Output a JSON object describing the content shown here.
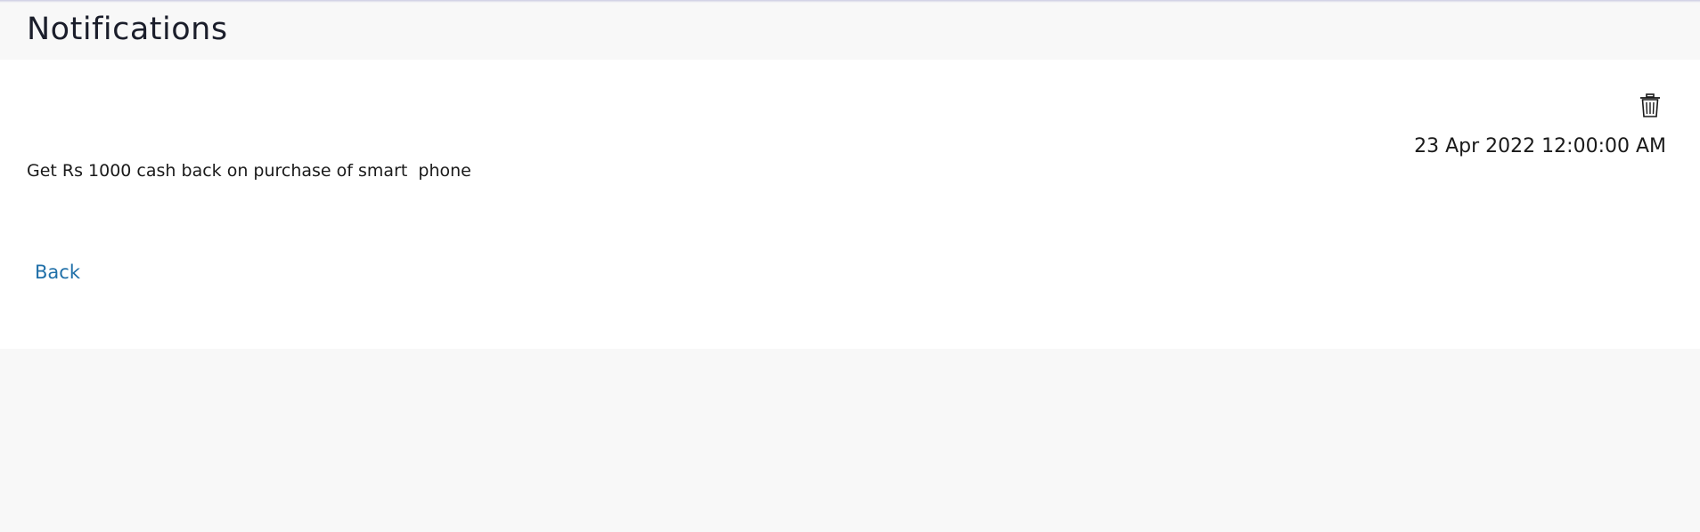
{
  "header": {
    "title": "Notifications"
  },
  "notification": {
    "message": "Get Rs 1000 cash back on purchase of smart  phone",
    "timestamp": "23 Apr 2022 12:00:00 AM",
    "delete_icon": "trash-icon"
  },
  "actions": {
    "back_label": "Back"
  },
  "colors": {
    "link": "#1f6fa8",
    "page_background": "#f8f8f8",
    "panel_background": "#ffffff",
    "text": "#1a1a1a"
  }
}
